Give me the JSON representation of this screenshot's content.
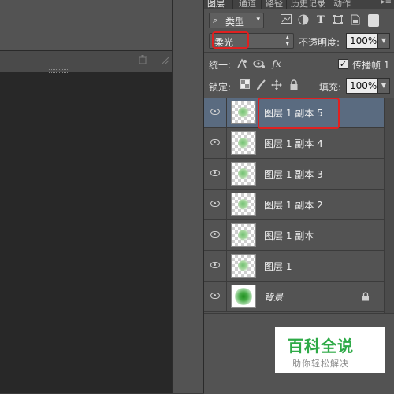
{
  "panel": {
    "tabs": [
      "图层",
      "通道",
      "路径",
      "历史记录",
      "动作"
    ],
    "active_tab": "图层",
    "filter_kind": "类型",
    "blend_mode": "柔光",
    "opacity_label": "不透明度:",
    "opacity_value": "100%",
    "unify_label": "统一:",
    "propagate_label": "传播帧 1",
    "lock_label": "锁定:",
    "fill_label": "填充:",
    "fill_value": "100%"
  },
  "layers": [
    {
      "name": "图层 1 副本 5",
      "selected": true
    },
    {
      "name": "图层 1 副本 4",
      "selected": false
    },
    {
      "name": "图层 1 副本 3",
      "selected": false
    },
    {
      "name": "图层 1 副本 2",
      "selected": false
    },
    {
      "name": "图层 1 副本",
      "selected": false
    },
    {
      "name": "图层 1",
      "selected": false
    },
    {
      "name": "背景",
      "selected": false,
      "locked": true
    }
  ],
  "watermark": {
    "title": "百科全说",
    "subtitle": "助你轻松解决"
  },
  "colors": {
    "selection": "#5a6b80",
    "annotation": "#e02020",
    "watermark_green": "#2eaa47"
  }
}
